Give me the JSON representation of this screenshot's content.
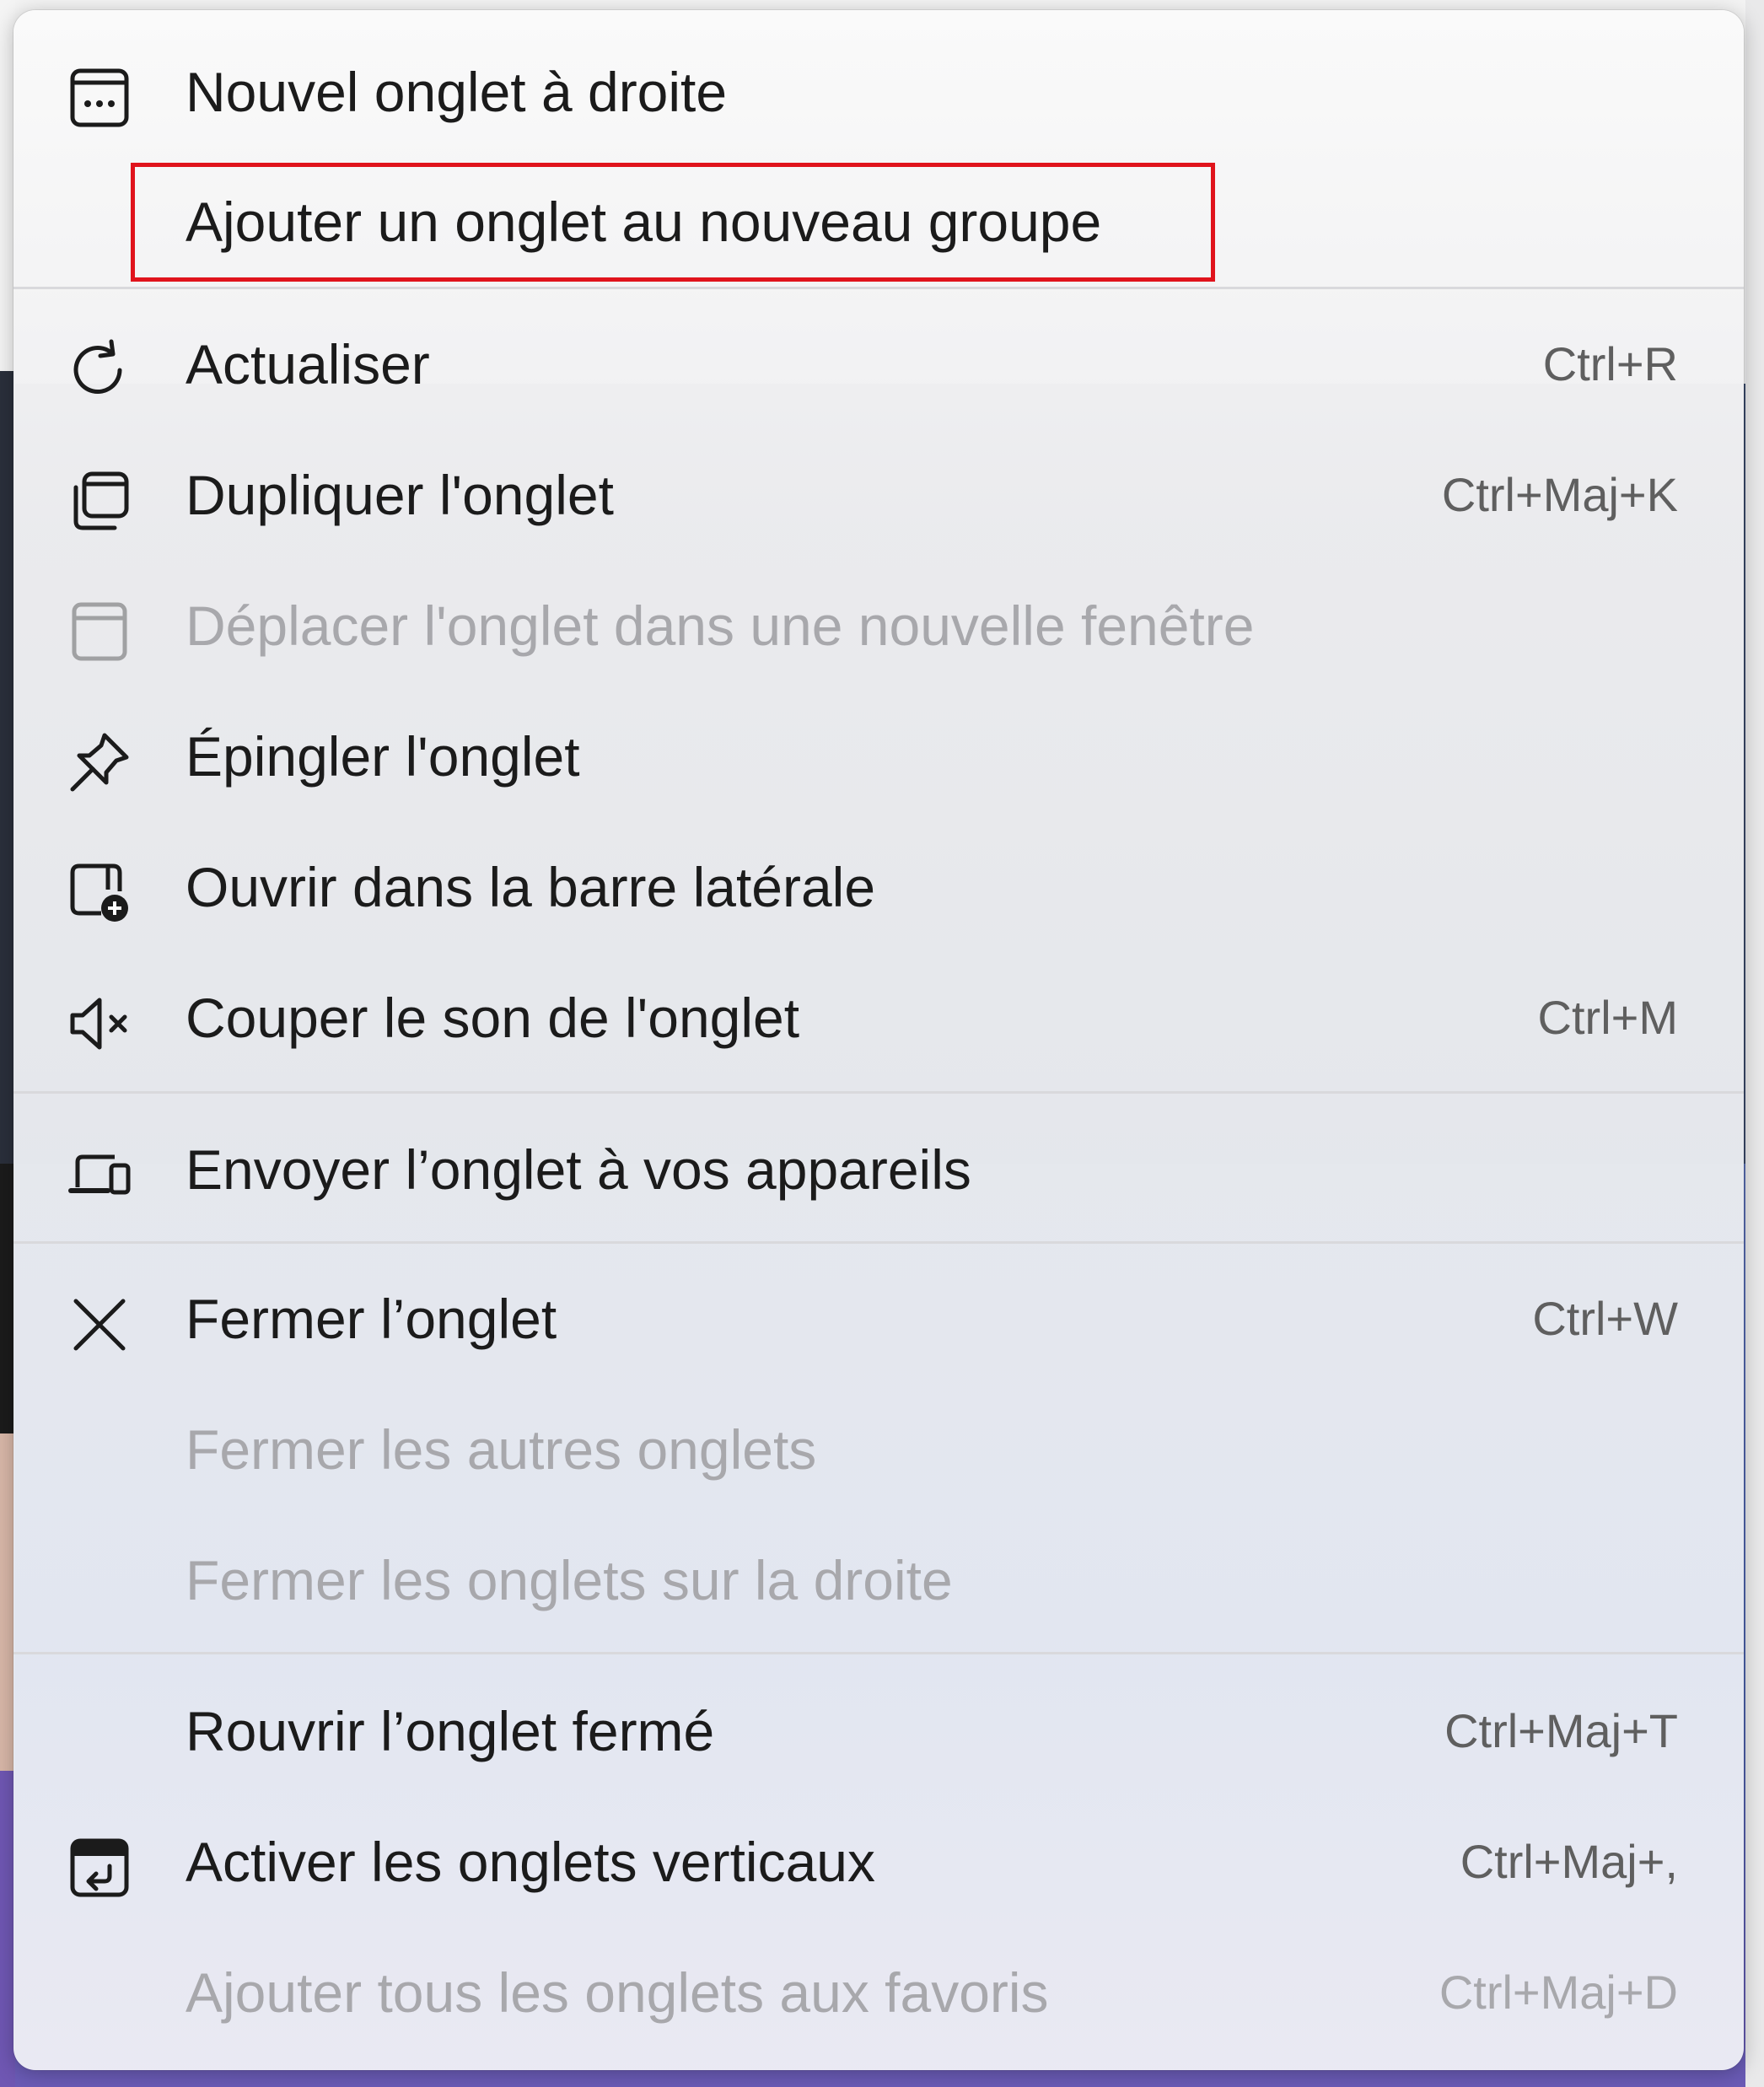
{
  "menu": {
    "items": [
      {
        "label": "Nouvel onglet à droite",
        "shortcut": "",
        "icon": "new-tab-right-icon",
        "enabled": true
      },
      {
        "label": "Ajouter un onglet au nouveau groupe",
        "shortcut": "",
        "icon": "",
        "enabled": true,
        "highlighted": true
      },
      {
        "label": "Actualiser",
        "shortcut": "Ctrl+R",
        "icon": "refresh-icon",
        "enabled": true
      },
      {
        "label": "Dupliquer l'onglet",
        "shortcut": "Ctrl+Maj+K",
        "icon": "duplicate-icon",
        "enabled": true
      },
      {
        "label": "Déplacer l'onglet dans une nouvelle fenêtre",
        "shortcut": "",
        "icon": "new-window-icon",
        "enabled": false
      },
      {
        "label": "Épingler l'onglet",
        "shortcut": "",
        "icon": "pin-icon",
        "enabled": true
      },
      {
        "label": "Ouvrir dans la barre latérale",
        "shortcut": "",
        "icon": "sidebar-add-icon",
        "enabled": true
      },
      {
        "label": "Couper le son de l'onglet",
        "shortcut": "Ctrl+M",
        "icon": "mute-icon",
        "enabled": true
      },
      {
        "label": "Envoyer l’onglet à vos appareils",
        "shortcut": "",
        "icon": "devices-icon",
        "enabled": true
      },
      {
        "label": "Fermer l’onglet",
        "shortcut": "Ctrl+W",
        "icon": "close-icon",
        "enabled": true
      },
      {
        "label": "Fermer les autres onglets",
        "shortcut": "",
        "icon": "",
        "enabled": false
      },
      {
        "label": "Fermer les onglets sur la droite",
        "shortcut": "",
        "icon": "",
        "enabled": false
      },
      {
        "label": "Rouvrir l’onglet fermé",
        "shortcut": "Ctrl+Maj+T",
        "icon": "",
        "enabled": true
      },
      {
        "label": "Activer les onglets verticaux",
        "shortcut": "Ctrl+Maj+,",
        "icon": "vertical-tabs-icon",
        "enabled": true
      },
      {
        "label": "Ajouter tous les onglets aux favoris",
        "shortcut": "Ctrl+Maj+D",
        "icon": "",
        "enabled": false
      }
    ]
  },
  "colors": {
    "highlight_border": "#e0131c",
    "text": "#1b1b1b",
    "disabled_text": "#a8a8ac",
    "shortcut_text": "#5f5f5f"
  }
}
